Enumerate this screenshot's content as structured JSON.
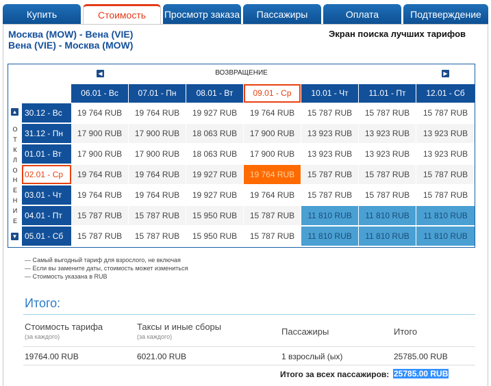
{
  "tabs": [
    {
      "label": "Купить"
    },
    {
      "label": "Стоимость"
    },
    {
      "label": "Просмотр заказа"
    },
    {
      "label": "Пассажиры"
    },
    {
      "label": "Оплата"
    },
    {
      "label": "Подтверждение"
    }
  ],
  "active_tab": "Стоимость",
  "route": {
    "outbound": "Москва (MOW) - Вена (VIE)",
    "inbound": "Вена (VIE) - Москва (MOW)"
  },
  "screen_title": "Экран поиска лучших тарифов",
  "calendar": {
    "return_label": "ВОЗВРАЩЕНИЕ",
    "departure_letters": [
      "О",
      "Т",
      "К",
      "Л",
      "О",
      "Н",
      "Е",
      "Н",
      "И",
      "Е"
    ],
    "return_dates": [
      "06.01 - Вс",
      "07.01 - Пн",
      "08.01 - Вт",
      "09.01 - Ср",
      "10.01 - Чт",
      "11.01 - Пт",
      "12.01 - Сб"
    ],
    "selected_return": "09.01 - Ср",
    "selected_departure": "02.01 - Ср",
    "rows": [
      {
        "date": "30.12 - Вс",
        "prices": [
          "19 764 RUB",
          "19 764 RUB",
          "19 927 RUB",
          "19 764 RUB",
          "15 787 RUB",
          "15 787 RUB",
          "15 787 RUB"
        ]
      },
      {
        "date": "31.12 - Пн",
        "prices": [
          "17 900 RUB",
          "17 900 RUB",
          "18 063 RUB",
          "17 900 RUB",
          "13 923 RUB",
          "13 923 RUB",
          "13 923 RUB"
        ]
      },
      {
        "date": "01.01 - Вт",
        "prices": [
          "17 900 RUB",
          "17 900 RUB",
          "18 063 RUB",
          "17 900 RUB",
          "13 923 RUB",
          "13 923 RUB",
          "13 923 RUB"
        ]
      },
      {
        "date": "02.01 - Ср",
        "prices": [
          "19 764 RUB",
          "19 764 RUB",
          "19 927 RUB",
          "19 764 RUB",
          "15 787 RUB",
          "15 787 RUB",
          "15 787 RUB"
        ]
      },
      {
        "date": "03.01 - Чт",
        "prices": [
          "19 764 RUB",
          "19 764 RUB",
          "19 927 RUB",
          "19 764 RUB",
          "15 787 RUB",
          "15 787 RUB",
          "15 787 RUB"
        ]
      },
      {
        "date": "04.01 - Пт",
        "prices": [
          "15 787 RUB",
          "15 787 RUB",
          "15 950 RUB",
          "15 787 RUB",
          "11 810 RUB",
          "11 810 RUB",
          "11 810 RUB"
        ]
      },
      {
        "date": "05.01 - Сб",
        "prices": [
          "15 787 RUB",
          "15 787 RUB",
          "15 950 RUB",
          "15 787 RUB",
          "11 810 RUB",
          "11 810 RUB",
          "11 810 RUB"
        ]
      }
    ],
    "cheapest_price": "11 810 RUB"
  },
  "notes": [
    "— Самый выгодный тариф для взрослого, не включая",
    "— Если вы замените даты, стоимость может измениться",
    "— Стоимость указана в RUB"
  ],
  "summary": {
    "title": "Итого:",
    "fare_label": "Стоимость тарифа",
    "fare_sub": "(за каждого)",
    "taxes_label": "Таксы и иные сборы",
    "taxes_sub": "(за каждого)",
    "passengers_label": "Пассажиры",
    "total_label": "Итого",
    "fare_value": "19764.00 RUB",
    "taxes_value": "6021.00 RUB",
    "passengers_value": "1 взрослый (ых)",
    "total_value": "25785.00 RUB",
    "grand_label": "Итого за всех пассажиров:",
    "grand_value": "25785.00 RUB"
  },
  "colors": {
    "tab_blue": "#12509a",
    "accent_orange": "#ff6b00",
    "cheap_blue": "#4aa0d3",
    "title_blue": "#2a7cc7"
  }
}
